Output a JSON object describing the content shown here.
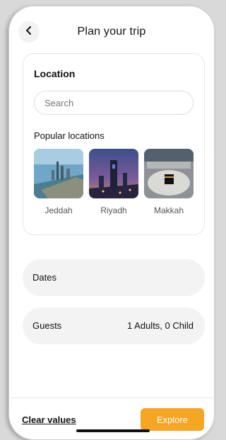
{
  "header": {
    "title": "Plan your trip",
    "back_icon": "chevron-left-icon"
  },
  "location": {
    "title": "Location",
    "search_placeholder": "Search",
    "popular_label": "Popular locations",
    "items": [
      {
        "name": "Jeddah"
      },
      {
        "name": "Riyadh"
      },
      {
        "name": "Makkah"
      }
    ]
  },
  "dates": {
    "label": "Dates"
  },
  "guests": {
    "label": "Guests",
    "value": "1 Adults, 0 Child"
  },
  "footer": {
    "clear_label": "Clear values",
    "explore_label": "Explore"
  },
  "colors": {
    "accent": "#f6a623",
    "pill_bg": "#f3f3f3"
  }
}
